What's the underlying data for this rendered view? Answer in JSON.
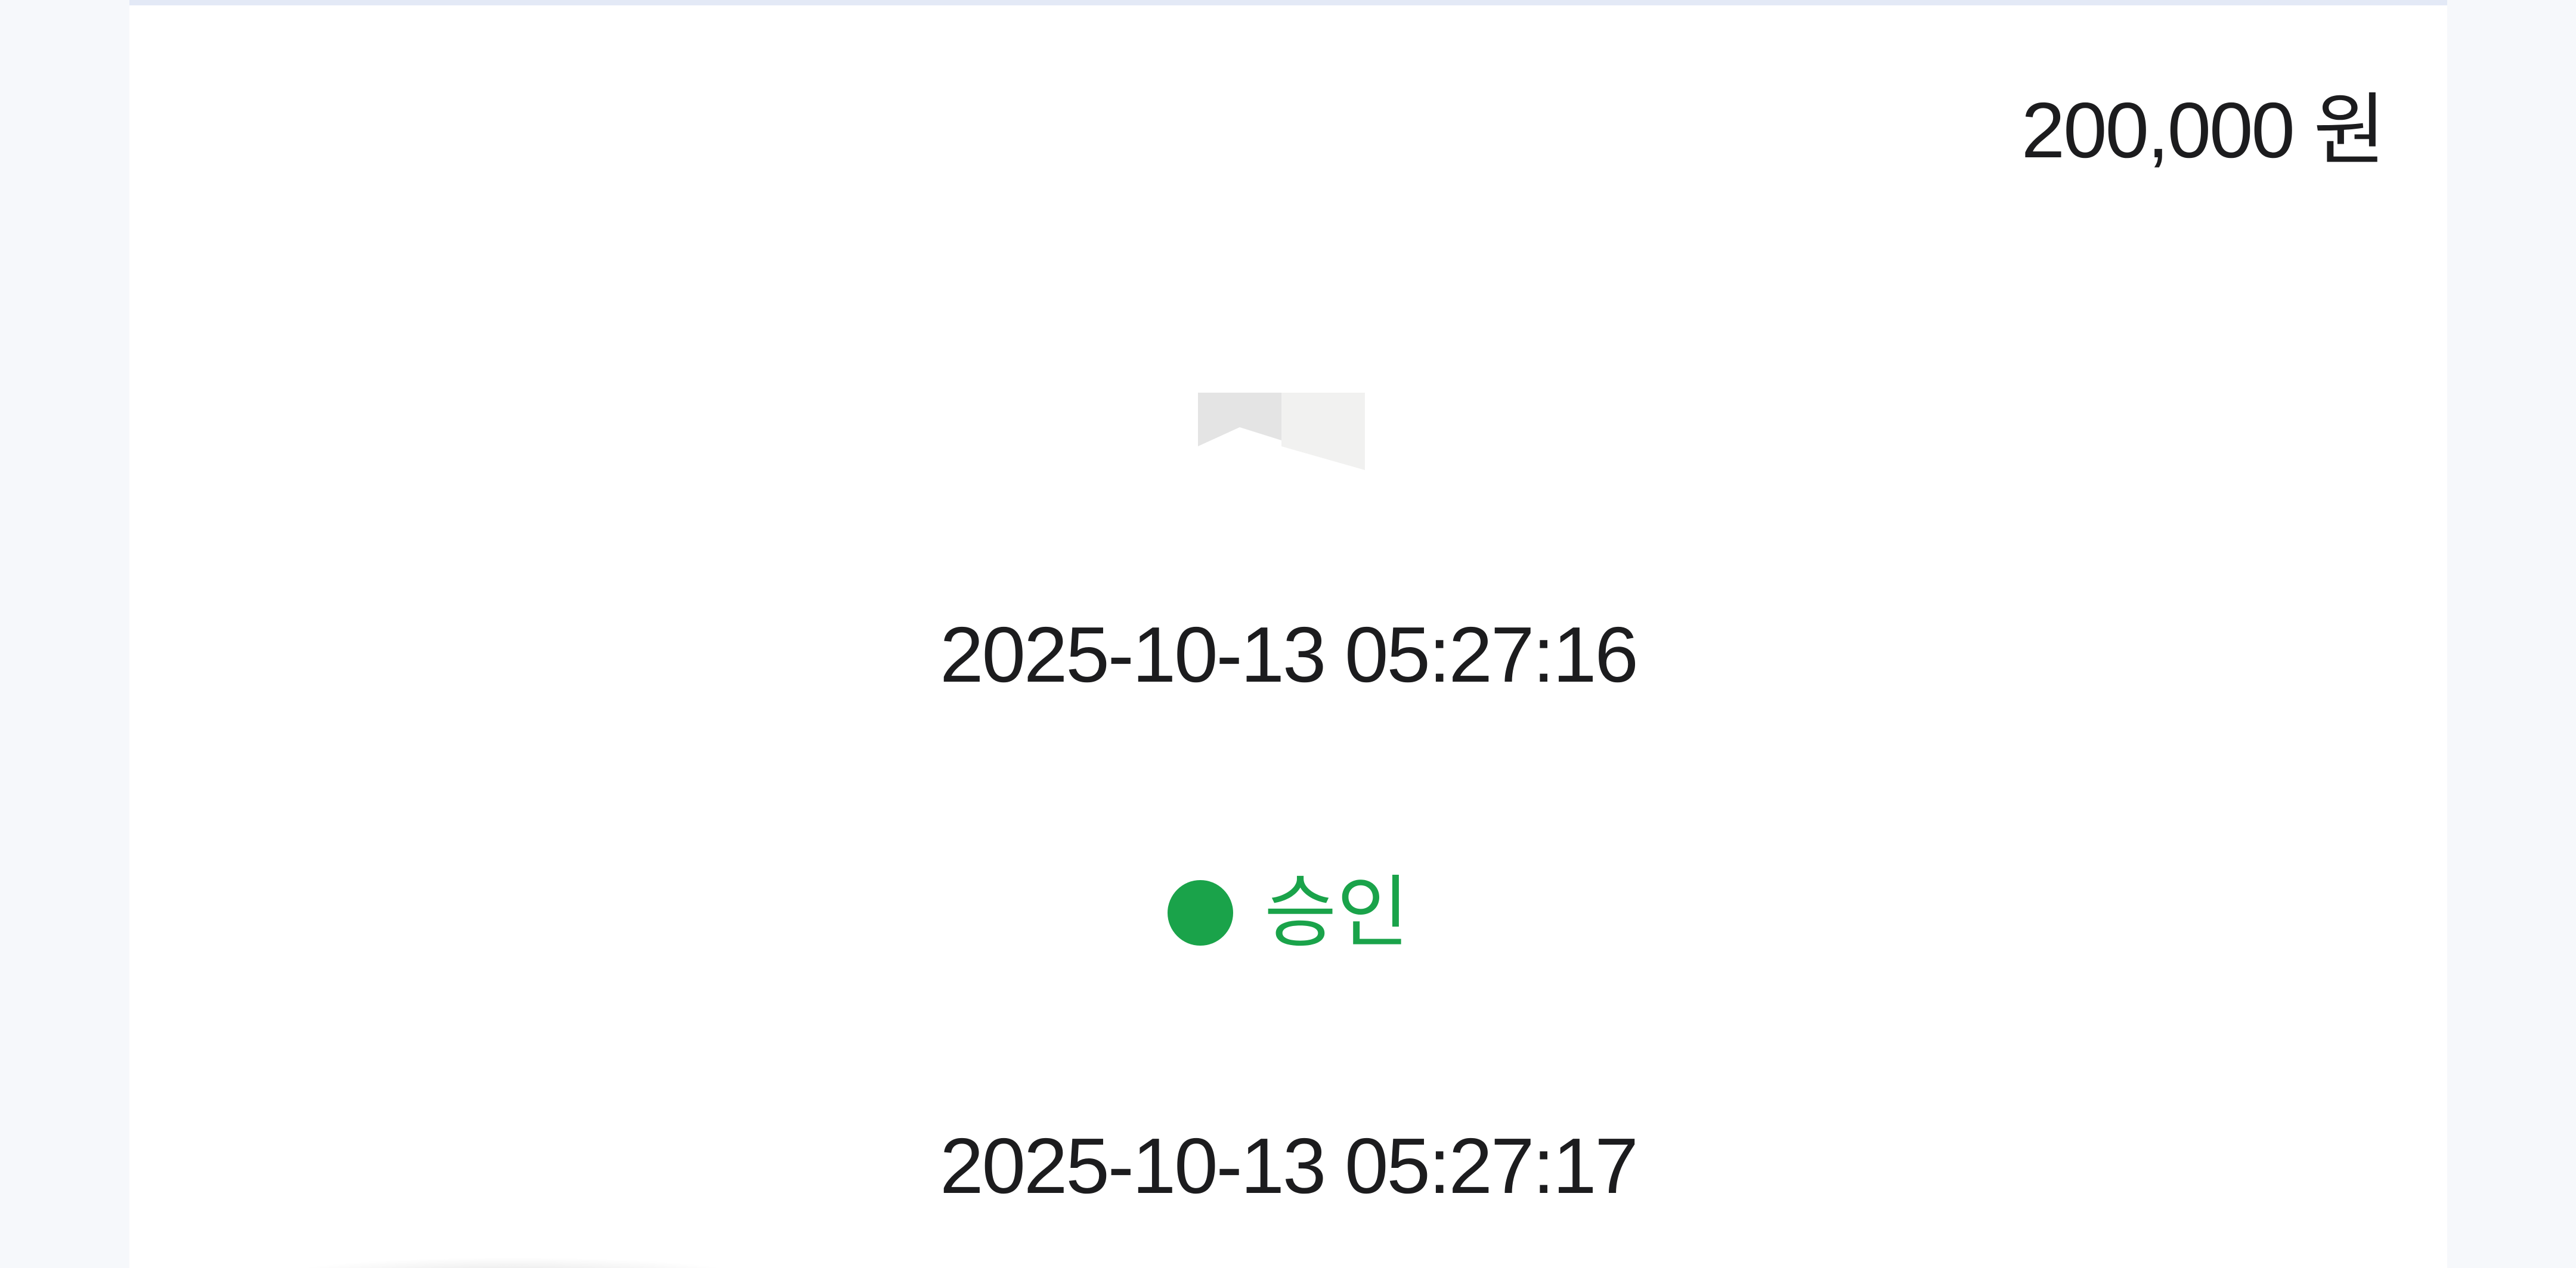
{
  "transaction": {
    "amount": "200,000 원",
    "requested_at": "2025-10-13 05:27:16",
    "status": {
      "label": "승인",
      "color": "#1aa34a"
    },
    "approved_at": "2025-10-13 05:27:17",
    "thumbnail_icon": "broken-image-icon"
  },
  "colors": {
    "page_background": "#f6f8fb",
    "card_background": "#ffffff",
    "card_top_border": "#e3e9f6",
    "text": "#1c1c1e",
    "status_green": "#1aa34a"
  }
}
